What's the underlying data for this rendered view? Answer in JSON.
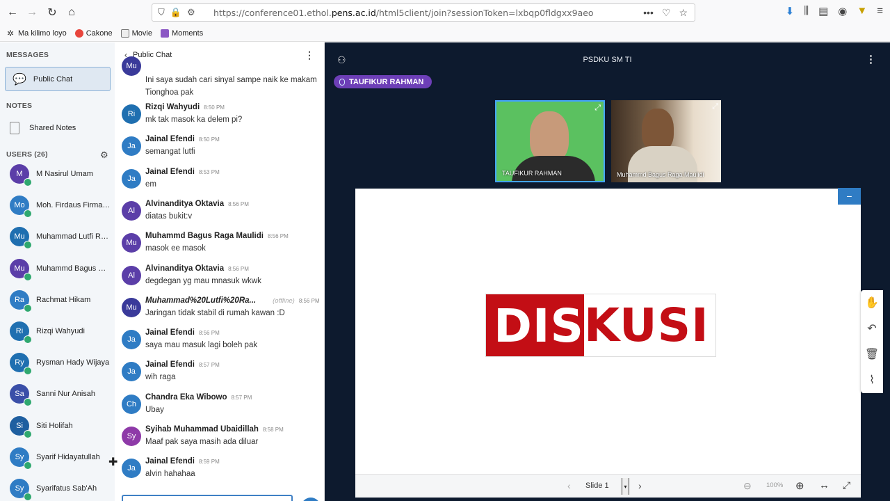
{
  "browser": {
    "url_prefix": "https://conference01.ethol.",
    "url_domain": "pens.ac.id",
    "url_suffix": "/html5client/join?sessionToken=lxbqp0fldgxx9aeo",
    "bookmarks": [
      "Ma kilimo loyo",
      "Cakone",
      "Movie",
      "Moments"
    ]
  },
  "sidebar": {
    "messages_title": "MESSAGES",
    "public_chat": "Public Chat",
    "notes_title": "NOTES",
    "shared_notes": "Shared Notes",
    "users_title": "USERS (26)",
    "users": [
      {
        "initials": "M",
        "name": "M Nasirul Umam",
        "color": "#5b3ea8"
      },
      {
        "initials": "Mo",
        "name": "Moh. Firdaus Firman...",
        "color": "#2f7cc4"
      },
      {
        "initials": "Mu",
        "name": "Muhammad Lutfi Ra...",
        "color": "#1f6fb0"
      },
      {
        "initials": "Mu",
        "name": "Muhammd Bagus Ra...",
        "color": "#5b3ea8"
      },
      {
        "initials": "Ra",
        "name": "Rachmat Hikam",
        "color": "#2f7cc4"
      },
      {
        "initials": "Ri",
        "name": "Rizqi Wahyudi",
        "color": "#1f6fb0"
      },
      {
        "initials": "Ry",
        "name": "Rysman Hady Wijaya",
        "color": "#1f6fb0"
      },
      {
        "initials": "Sa",
        "name": "Sanni Nur Anisah",
        "color": "#3a4fa8"
      },
      {
        "initials": "Si",
        "name": "Siti Holifah",
        "color": "#1f5fa0"
      },
      {
        "initials": "Sy",
        "name": "Syarif Hidayatullah",
        "color": "#2f7cc4"
      },
      {
        "initials": "Sy",
        "name": "Syarifatus Sab'Ah",
        "color": "#2f7cc4"
      }
    ]
  },
  "chat": {
    "title": "Public Chat",
    "messages": [
      {
        "initials": "Mu",
        "name": "",
        "time": "",
        "text": "Ini saya sudah cari sinyal sampe naik ke makam",
        "text2": "Tionghoa pak",
        "color": "#3a3a9a",
        "partial": true
      },
      {
        "initials": "Ri",
        "name": "Rizqi Wahyudi",
        "time": "8:50 PM",
        "text": "mk tak masok ka delem pi?",
        "color": "#1f6fb0"
      },
      {
        "initials": "Ja",
        "name": "Jainal Efendi",
        "time": "8:50 PM",
        "text": "semangat lutfi",
        "color": "#2f7cc4"
      },
      {
        "initials": "Ja",
        "name": "Jainal Efendi",
        "time": "8:53 PM",
        "text": "em",
        "color": "#2f7cc4"
      },
      {
        "initials": "Al",
        "name": "Alvinanditya Oktavia",
        "time": "8:56 PM",
        "text": "diatas bukit:v",
        "color": "#5b3ea8"
      },
      {
        "initials": "Mu",
        "name": "Muhammd Bagus Raga Maulidi",
        "time": "8:56 PM",
        "text": "masok ee masok",
        "color": "#5b3ea8"
      },
      {
        "initials": "Al",
        "name": "Alvinanditya Oktavia",
        "time": "8:56 PM",
        "text": "degdegan yg mau mnasuk wkwk",
        "color": "#5b3ea8"
      },
      {
        "initials": "Mu",
        "name": "Muhammad%20Lutfi%20Ra...",
        "time": "8:56 PM",
        "offline": "(offline)",
        "text": "Jaringan tidak stabil di rumah kawan :D",
        "color": "#3a3a9a"
      },
      {
        "initials": "Ja",
        "name": "Jainal Efendi",
        "time": "8:56 PM",
        "text": "saya mau masuk lagi boleh pak",
        "color": "#2f7cc4"
      },
      {
        "initials": "Ja",
        "name": "Jainal Efendi",
        "time": "8:57 PM",
        "text": "wih raga",
        "color": "#2f7cc4"
      },
      {
        "initials": "Ch",
        "name": "Chandra Eka Wibowo",
        "time": "8:57 PM",
        "text": "Ubay",
        "color": "#2f7cc4"
      },
      {
        "initials": "Sy",
        "name": "Syihab Muhammad Ubaidillah",
        "time": "8:58 PM",
        "text": "Maaf pak saya masih ada diluar",
        "color": "#8e3aa8"
      },
      {
        "initials": "Ja",
        "name": "Jainal Efendi",
        "time": "8:59 PM",
        "text": "alvin hahahaa",
        "color": "#2f7cc4"
      }
    ]
  },
  "stage": {
    "title": "PSDKU SM TI",
    "talker": "TAUFIKUR RAHMAN",
    "videos": [
      "TAUFIKUR RAHMAN",
      "Muhammd Bagus Raga Maulidi"
    ],
    "slide_text_red": "DIS",
    "slide_text_white": "KUSI",
    "slide_label": "Slide 1",
    "zoom": "100%",
    "minimize": "−"
  }
}
